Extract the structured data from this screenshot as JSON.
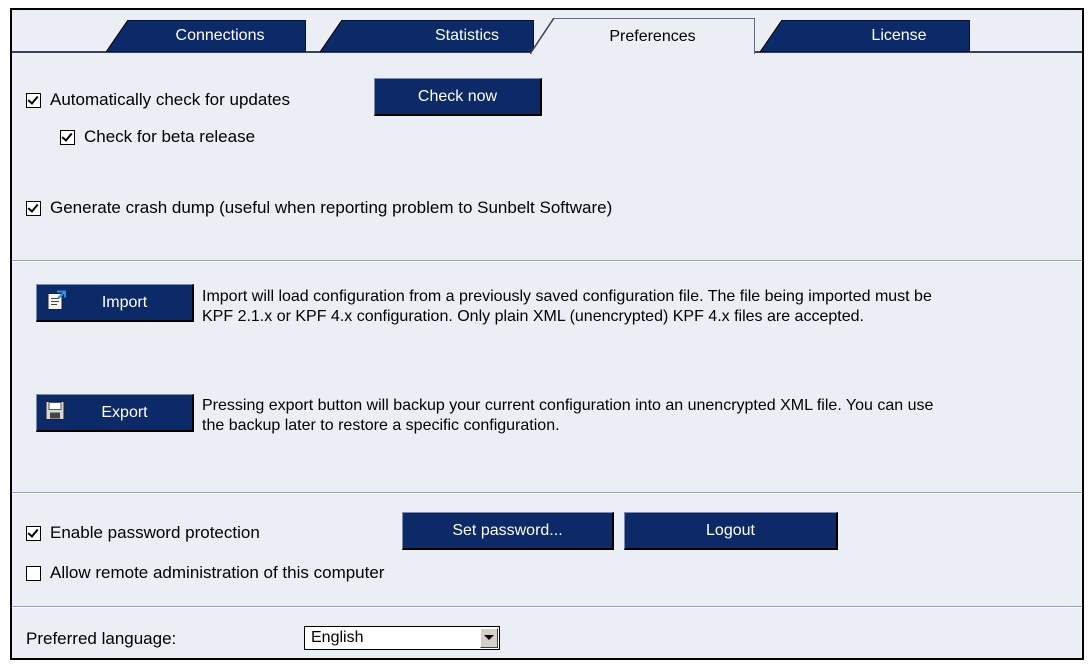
{
  "tabs": [
    {
      "label": "Connections",
      "active": false
    },
    {
      "label": "Statistics",
      "active": false
    },
    {
      "label": "Preferences",
      "active": true
    },
    {
      "label": "License",
      "active": false
    }
  ],
  "updates": {
    "auto_check_label": "Automatically check for updates",
    "auto_check_checked": true,
    "check_now_label": "Check now",
    "beta_label": "Check for beta release",
    "beta_checked": true
  },
  "crash_dump": {
    "label": "Generate crash dump (useful when reporting problem to Sunbelt Software)",
    "checked": true
  },
  "import": {
    "button_label": "Import",
    "icon": "import-icon",
    "desc_line1": "Import will load configuration from a previously saved configuration file. The file being imported must be",
    "desc_line2": "KPF 2.1.x or KPF 4.x configuration. Only plain XML (unencrypted) KPF 4.x files are accepted."
  },
  "export": {
    "button_label": "Export",
    "icon": "floppy-disk-icon",
    "desc_line1": "Pressing export button will backup your current configuration into an unencrypted XML file. You can use",
    "desc_line2": "the backup later to restore a specific configuration."
  },
  "security": {
    "password_label": "Enable password protection",
    "password_checked": true,
    "set_password_label": "Set password...",
    "logout_label": "Logout",
    "remote_label": "Allow remote administration of this computer",
    "remote_checked": false
  },
  "language": {
    "label": "Preferred language:",
    "selected": "English"
  },
  "colors": {
    "tab_blue": "#0c2a67",
    "button_blue": "#0c2a67",
    "panel_bg": "#ebeef5"
  }
}
